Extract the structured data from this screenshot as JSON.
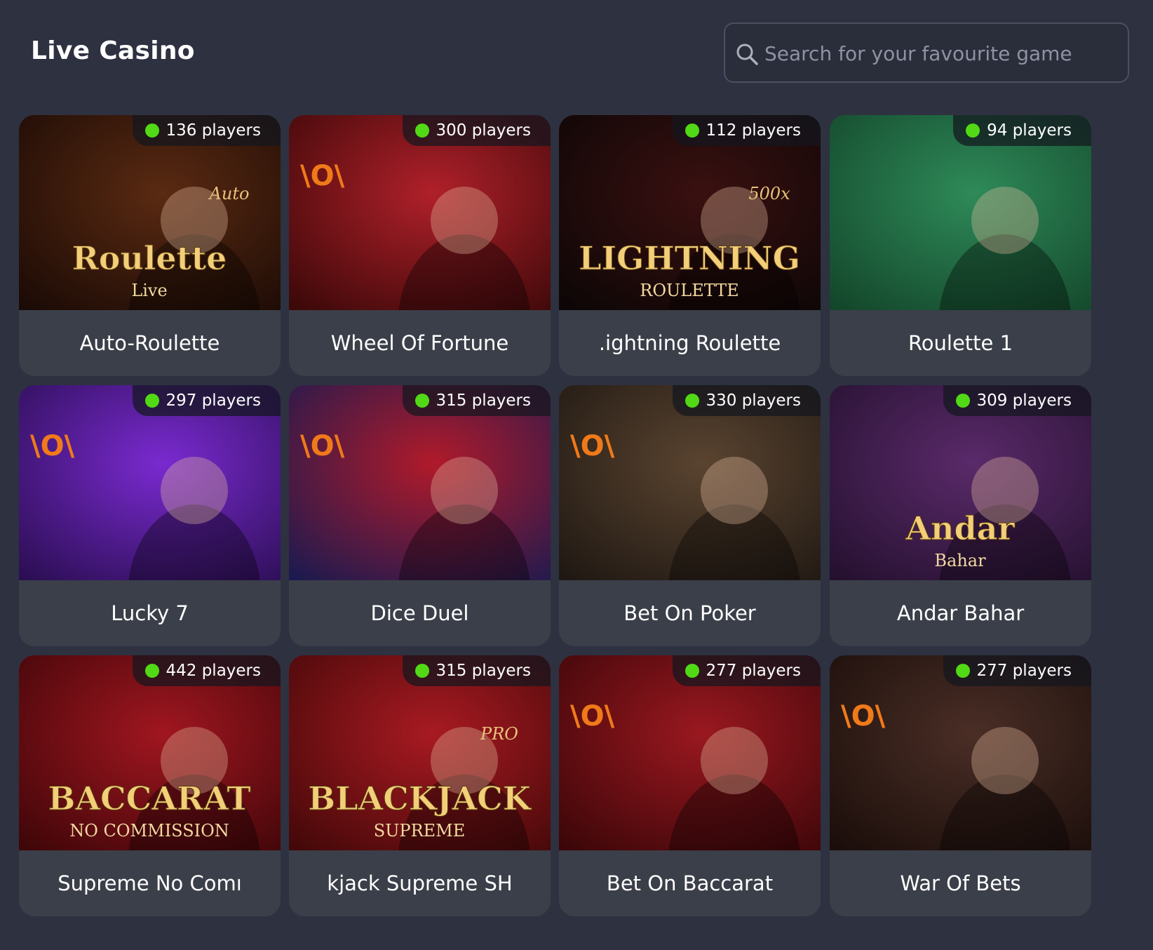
{
  "header": {
    "title": "Live Casino"
  },
  "search": {
    "placeholder": "Search for your favourite game"
  },
  "games": [
    {
      "name": "Auto-Roulette",
      "players": "136 players",
      "art_text": "Roulette",
      "art_sub": "Live",
      "art_top": "Auto",
      "bg1": "#5a2a12",
      "bg2": "#1a0a05"
    },
    {
      "name": "Wheel Of Fortune",
      "players": "300 players",
      "logo": "\\O\\",
      "bg1": "#b0202a",
      "bg2": "#3a0808"
    },
    {
      "name": ".ightning Roulette",
      "players": "112 players",
      "art_text": "LIGHTNING",
      "art_sub": "ROULETTE",
      "art_top": "500x",
      "bg1": "#3a1010",
      "bg2": "#0c0606"
    },
    {
      "name": "Roulette 1",
      "players": "94 players",
      "bg1": "#2e8a58",
      "bg2": "#13452a"
    },
    {
      "name": "Lucky 7",
      "players": "297 players",
      "logo": "\\O\\",
      "bg1": "#7a2ad0",
      "bg2": "#2a0e52"
    },
    {
      "name": "Dice Duel",
      "players": "315 players",
      "logo": "\\O\\",
      "bg1": "#b01a2a",
      "bg2": "#1a1a50"
    },
    {
      "name": "Bet On Poker",
      "players": "330 players",
      "logo": "\\O\\",
      "bg1": "#5a4430",
      "bg2": "#1e1712"
    },
    {
      "name": "Andar Bahar",
      "players": "309 players",
      "art_text": "Andar",
      "art_sub": "Bahar",
      "bg1": "#5a2a6a",
      "bg2": "#24102e"
    },
    {
      "name": "Supreme No Comı",
      "players": "442 players",
      "art_text": "BACCARAT",
      "art_sub": "NO COMMISSION",
      "bg1": "#a01620",
      "bg2": "#3e0608"
    },
    {
      "name": "kjack Supreme SH",
      "players": "315 players",
      "art_text": "BLACKJACK",
      "art_sub": "SUPREME",
      "art_top": "PRO",
      "bg1": "#a81a22",
      "bg2": "#420808"
    },
    {
      "name": "Bet On Baccarat",
      "players": "277 players",
      "logo": "\\O\\",
      "bg1": "#9a1820",
      "bg2": "#3a0608"
    },
    {
      "name": "War Of Bets",
      "players": "277 players",
      "logo": "\\O\\",
      "bg1": "#4a2e26",
      "bg2": "#1a0d0a"
    }
  ]
}
